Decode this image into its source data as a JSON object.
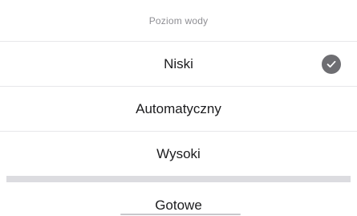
{
  "sheet": {
    "title": "Poziom wody",
    "options": [
      {
        "label": "Niski",
        "selected": true
      },
      {
        "label": "Automatyczny",
        "selected": false
      },
      {
        "label": "Wysoki",
        "selected": false
      }
    ],
    "done_label": "Gotowe"
  },
  "icons": {
    "selected": "checkmark-circle-icon"
  },
  "colors": {
    "check_fill": "#6e6e72",
    "header_text": "#8e8e93",
    "separator": "#dcdce0"
  }
}
